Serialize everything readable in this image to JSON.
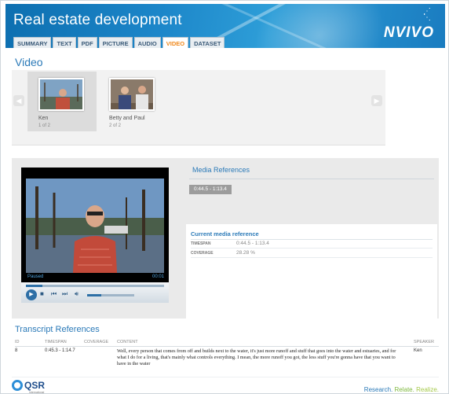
{
  "header": {
    "title": "Real estate development",
    "brand": "NVIVO",
    "tabs": [
      {
        "label": "SUMMARY"
      },
      {
        "label": "TEXT"
      },
      {
        "label": "PDF"
      },
      {
        "label": "PICTURE"
      },
      {
        "label": "AUDIO"
      },
      {
        "label": "VIDEO",
        "active": true
      },
      {
        "label": "DATASET"
      }
    ]
  },
  "video_section": {
    "title": "Video",
    "thumbnails": [
      {
        "name": "Ken",
        "count": "1 of 2",
        "selected": true
      },
      {
        "name": "Betty and Paul",
        "count": "2 of 2",
        "selected": false
      }
    ]
  },
  "player": {
    "status": "Paused",
    "time": "00:01",
    "seek_progress": 0.12,
    "volume_level": 0.3
  },
  "media_references": {
    "title": "Media References",
    "timespan": "0:44.5 - 1:13.4"
  },
  "current_reference": {
    "title": "Current media reference",
    "rows": [
      {
        "key": "TIMESPAN",
        "value": "0:44.5 - 1:13.4"
      },
      {
        "key": "COVERAGE",
        "value": "28.28 %"
      }
    ]
  },
  "transcript": {
    "title": "Transcript References",
    "headers": {
      "id": "ID",
      "timespan": "TIMESPAN",
      "coverage": "COVERAGE",
      "content": "CONTENT",
      "speaker": "SPEAKER"
    },
    "rows": [
      {
        "id": "8",
        "timespan": "0:45.3 - 1:14.7",
        "coverage": "",
        "content": "Well, every person that comes from off and builds next to the water, it's just more runoff and stuff that goes into the water and estuaries, and for what I do for a living, that's mainly what controls everything. I mean, the more runoff you got, the less stuff you're gonna have that you want to have in the water",
        "speaker": "Ken"
      }
    ]
  },
  "footer": {
    "logo_text": "QSR",
    "logo_sub": "International",
    "tagline": [
      "Research.",
      "Relate.",
      "Realize."
    ]
  },
  "colors": {
    "accent_blue": "#2b7ab8",
    "active_tab": "#f08a1e",
    "header_blue": "#1c86c9"
  }
}
